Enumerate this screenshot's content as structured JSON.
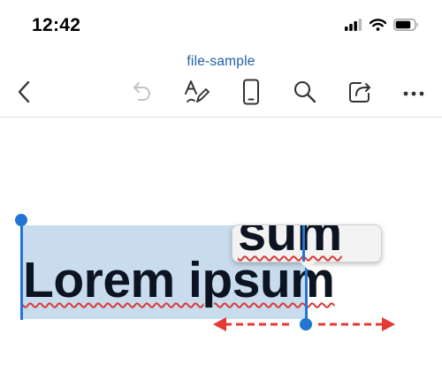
{
  "status_bar": {
    "time": "12:42",
    "icons": [
      "cellular-signal-icon",
      "wifi-icon",
      "battery-icon"
    ]
  },
  "document": {
    "title": "file-sample",
    "text_before": "Lorem ",
    "text_misspelled": "ipsum",
    "magnifier_text": "sum"
  },
  "toolbar": {
    "buttons": [
      "back-chevron-icon",
      "undo-icon",
      "draw-pen-icon",
      "mobile-view-icon",
      "search-icon",
      "share-icon",
      "more-options-icon"
    ]
  },
  "colors": {
    "accent": "#2176d3",
    "selection": "#c9dcee",
    "title": "#1f5fa8",
    "spellcheck": "#d83a3a",
    "drag_arrows": "#e53935"
  }
}
